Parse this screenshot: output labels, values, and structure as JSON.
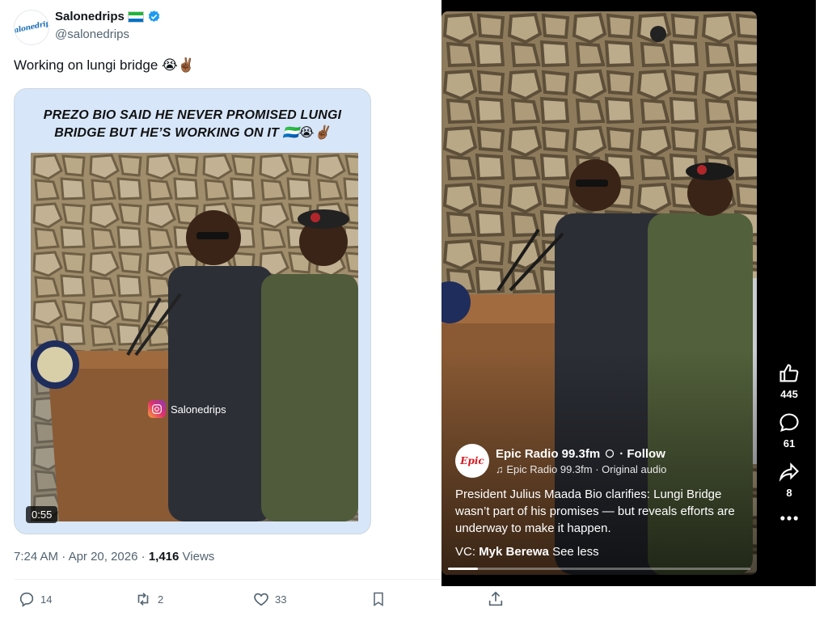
{
  "tweet": {
    "display_name": "Salonedrips",
    "handle": "@salonedrips",
    "avatar_text": "Salonedrips",
    "text": "Working on lungi bridge 😭✌🏾",
    "media": {
      "headline_line1": "PREZO BIO SAID HE NEVER PROMISED LUNGI",
      "headline_line2": "BRIDGE BUT HE’S WORKING ON IT 🇸🇱😭✌🏾",
      "watermark": "Salonedrips",
      "duration": "0:55"
    },
    "time": "7:24 AM",
    "date": "Apr 20, 2026",
    "views_count": "1,416",
    "views_label": "Views",
    "replies": "14",
    "retweets": "2",
    "likes": "33"
  },
  "reel": {
    "account": "Epic Radio 99.3fm",
    "follow_label": "· Follow",
    "avatar_text": "Epic",
    "audio": "Epic Radio 99.3fm · Original audio",
    "caption": "President Julius Maada Bio clarifies: Lungi Bridge wasn’t part of his promises — but reveals efforts are underway to make it happen.",
    "vc_prefix": "VC:",
    "vc_name": "Myk Berewa",
    "see_less": "See less",
    "likes": "445",
    "comments": "61",
    "shares": "8",
    "progress_fraction": 0.1
  },
  "colors": {
    "verified_blue": "#1d9bf0",
    "flag_green": "#1eb53a",
    "flag_white": "#ffffff",
    "flag_blue": "#0072c6",
    "media_bg": "#d7e6f9"
  },
  "icons": [
    "verified-badge-icon",
    "reply-icon",
    "retweet-icon",
    "like-icon",
    "bookmark-icon",
    "share-icon",
    "instagram-icon",
    "like-thumb-icon",
    "comment-icon",
    "share-arrow-icon",
    "more-icon",
    "music-note-icon"
  ]
}
